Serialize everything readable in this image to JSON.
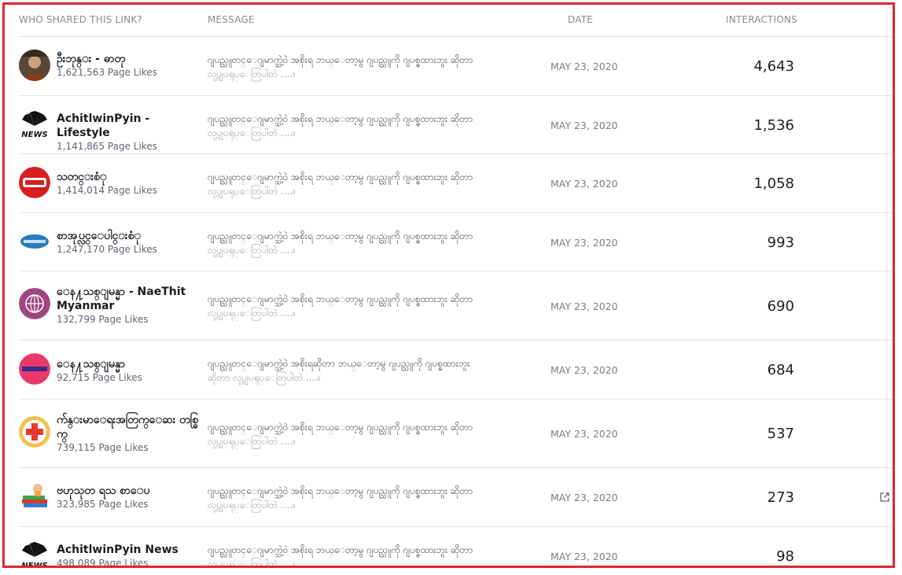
{
  "columns": {
    "who": "WHO SHARED THIS LINK?",
    "message": "MESSAGE",
    "date": "DATE",
    "interactions": "INTERACTIONS"
  },
  "rows": [
    {
      "name": "ဦးဘုန္း - ဓာတု",
      "likes": "1,621,563 Page Likes",
      "msg1": "ဂျပည္သူတင္ေဂျမာက္သဲ့ဝဲ အစိုးရ ဘယ္ေတာ့မွ ဂျပည္သူကို ဂျပစ္ဓထားဘူး ဆိုတာ",
      "msg2": "လုပ္ဂျပရုပ္ေတြပါတဲ ....။",
      "date": "MAY 23, 2020",
      "interactions": "4,643",
      "avatar_icon": "monk-photo-icon"
    },
    {
      "name": "AchitlwinPyin - Lifestyle",
      "likes": "1,141,865 Page Likes",
      "msg1": "ဂျပည္သူတင္ေဂျမာက္သဲ့ဝဲ အစိုးရ ဘယ္ေတာ့မွ ဂျပည္သူကို ဂျပစ္ဓထားဘူး ဆိုတာ",
      "msg2": "လုပ္ဂျပရုပ္ေတြပါတဲ ....။",
      "date": "MAY 23, 2020",
      "interactions": "1,536",
      "avatar_icon": "peacock-news-logo-icon"
    },
    {
      "name": "သတင္းစံု",
      "likes": "1,414,014 Page Likes",
      "msg1": "ဂျပည္သူတင္ေဂျမာက္သဲ့ဝဲ အစိုးရ ဘယ္ေတာ့မွ ဂျပည္သူကို ဂျပစ္ဓထားဘူး ဆိုတာ",
      "msg2": "လုပ္ဂျပရုပ္ေတြပါတဲ ....။",
      "date": "MAY 23, 2020",
      "interactions": "1,058",
      "avatar_icon": "red-news-logo-icon"
    },
    {
      "name": "စာအုပ္လင္ေပါင္းစံု",
      "likes": "1,247,170 Page Likes",
      "msg1": "ဂျပည္သူတင္ေဂျမာက္သဲ့ဝဲ အစိုးရ ဘယ္ေတာ့မွ ဂျပည္သူကို ဂျပစ္ဓထားဘူး ဆိုတာ",
      "msg2": "လုပ္ဂျပရုပ္ေတြပါတဲ ....။",
      "date": "MAY 23, 2020",
      "interactions": "993",
      "avatar_icon": "blue-banner-logo-icon"
    },
    {
      "name": "ေန႔သစ္ျမန္မာ - NaeThit Myanmar",
      "likes": "132,799 Page Likes",
      "msg1": "ဂျပည္သူတင္ေဂျမာက္သဲ့ဝဲ အစိုးရ ဘယ္ေတာ့မွ ဂျပည္သူကို ဂျပစ္ဓထားဘူး ဆိုတာ",
      "msg2": "လုပ္ဂျပရုပ္ေတြပါတဲ ....။",
      "date": "MAY 23, 2020",
      "interactions": "690",
      "avatar_icon": "purple-globe-logo-icon"
    },
    {
      "name": "ေန႔သစ္ျမန္မာ",
      "likes": "92,715 Page Likes",
      "msg1": "ဂျပည္သူတင္ေဂျမာက္သဲ့ဝဲ အစိုးရဆိုတာ ဘယ္ေတာ့မွ ဂျပည္သူကို ဂျပစ္ဓထားဘူး",
      "msg2": "ဆိုတာ လုပ္ဂျပရုပ္ေတြပါတဲ ....။",
      "date": "MAY 23, 2020",
      "interactions": "684",
      "avatar_icon": "pink-banner-logo-icon"
    },
    {
      "name": "က်န္းမာေရးအတြက္ေဆး တစ္ခြက္",
      "likes": "739,115 Page Likes",
      "msg1": "ဂျပည္သူတင္ေဂျမာက္သဲ့ဝဲ အစိုးရ ဘယ္ေတာ့မွ ဂျပည္သူကို ဂျပစ္ဓထားဘူး ဆိုတာ",
      "msg2": "လုပ္ဂျပရုပ္ေတြပါတဲ ....။",
      "date": "MAY 23, 2020",
      "interactions": "537",
      "avatar_icon": "medical-cross-logo-icon"
    },
    {
      "name": "ဗဟုသုတ ရသ စာေပ",
      "likes": "323,985 Page Likes",
      "msg1": "ဂျပည္သူတင္ေဂျမာက္သဲ့ဝဲ အစိုးရ ဘယ္ေတာ့မွ ဂျပည္သူကို ဂျပစ္ဓထားဘူး ဆိုတာ",
      "msg2": "လုပ္ဂျပရုပ္ေတြပါတဲ ....။",
      "date": "MAY 23, 2020",
      "interactions": "273",
      "avatar_icon": "books-logo-icon",
      "external_link_icon": "external-link-icon"
    },
    {
      "name": "AchitlwinPyin News",
      "likes": "498,089 Page Likes",
      "msg1": "ဂျပည္သူတင္ေဂျမာက္သဲ့ဝဲ အစိုးရ ဘယ္ေတာ့မွ ဂျပည္သူကို ဂျပစ္ဓထားဘူး ဆိုတာ",
      "msg2": "လုပ္ဂျပရုပ္ေတြပါတဲ ....။",
      "date": "MAY 23, 2020",
      "interactions": "98",
      "avatar_icon": "peacock-news-logo-icon"
    }
  ],
  "colors": {
    "border": "#e0272e",
    "divider": "#e6e6e6",
    "muted": "#8a8d91"
  }
}
